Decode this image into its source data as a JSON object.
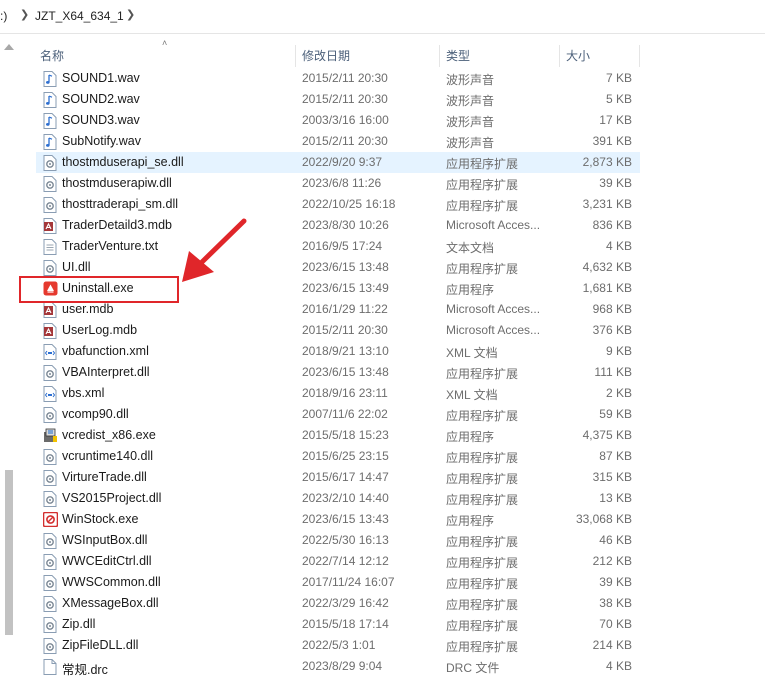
{
  "address": {
    "prefix": ":)",
    "crumb": "JZT_X64_634_1"
  },
  "columns": {
    "name": "名称",
    "date": "修改日期",
    "type": "类型",
    "size": "大小"
  },
  "files": [
    {
      "name": "SOUND1.wav",
      "date": "2015/2/11 20:30",
      "type": "波形声音",
      "size": "7 KB",
      "icon": "audio-file-icon"
    },
    {
      "name": "SOUND2.wav",
      "date": "2015/2/11 20:30",
      "type": "波形声音",
      "size": "5 KB",
      "icon": "audio-file-icon"
    },
    {
      "name": "SOUND3.wav",
      "date": "2003/3/16 16:00",
      "type": "波形声音",
      "size": "17 KB",
      "icon": "audio-file-icon"
    },
    {
      "name": "SubNotify.wav",
      "date": "2015/2/11 20:30",
      "type": "波形声音",
      "size": "391 KB",
      "icon": "audio-file-icon"
    },
    {
      "name": "thostmduserapi_se.dll",
      "date": "2022/9/20 9:37",
      "type": "应用程序扩展",
      "size": "2,873 KB",
      "icon": "dll-file-icon",
      "selected": true
    },
    {
      "name": "thostmduserapiw.dll",
      "date": "2023/6/8 11:26",
      "type": "应用程序扩展",
      "size": "39 KB",
      "icon": "dll-file-icon"
    },
    {
      "name": "thosttraderapi_sm.dll",
      "date": "2022/10/25 16:18",
      "type": "应用程序扩展",
      "size": "3,231 KB",
      "icon": "dll-file-icon"
    },
    {
      "name": "TraderDetaild3.mdb",
      "date": "2023/8/30 10:26",
      "type": "Microsoft Acces...",
      "size": "836 KB",
      "icon": "access-db-icon"
    },
    {
      "name": "TraderVenture.txt",
      "date": "2016/9/5 17:24",
      "type": "文本文档",
      "size": "4 KB",
      "icon": "text-file-icon"
    },
    {
      "name": "UI.dll",
      "date": "2023/6/15 13:48",
      "type": "应用程序扩展",
      "size": "4,632 KB",
      "icon": "dll-file-icon"
    },
    {
      "name": "Uninstall.exe",
      "date": "2023/6/15 13:49",
      "type": "应用程序",
      "size": "1,681 KB",
      "icon": "uninstall-app-icon"
    },
    {
      "name": "user.mdb",
      "date": "2016/1/29 11:22",
      "type": "Microsoft Acces...",
      "size": "968 KB",
      "icon": "access-db-icon"
    },
    {
      "name": "UserLog.mdb",
      "date": "2015/2/11 20:30",
      "type": "Microsoft Acces...",
      "size": "376 KB",
      "icon": "access-db-icon"
    },
    {
      "name": "vbafunction.xml",
      "date": "2018/9/21 13:10",
      "type": "XML 文档",
      "size": "9 KB",
      "icon": "xml-file-icon"
    },
    {
      "name": "VBAInterpret.dll",
      "date": "2023/6/15 13:48",
      "type": "应用程序扩展",
      "size": "111 KB",
      "icon": "dll-file-icon"
    },
    {
      "name": "vbs.xml",
      "date": "2018/9/16 23:11",
      "type": "XML 文档",
      "size": "2 KB",
      "icon": "xml-file-icon"
    },
    {
      "name": "vcomp90.dll",
      "date": "2007/11/6 22:02",
      "type": "应用程序扩展",
      "size": "59 KB",
      "icon": "dll-file-icon"
    },
    {
      "name": "vcredist_x86.exe",
      "date": "2015/5/18 15:23",
      "type": "应用程序",
      "size": "4,375 KB",
      "icon": "installer-icon"
    },
    {
      "name": "vcruntime140.dll",
      "date": "2015/6/25 23:15",
      "type": "应用程序扩展",
      "size": "87 KB",
      "icon": "dll-file-icon"
    },
    {
      "name": "VirtureTrade.dll",
      "date": "2015/6/17 14:47",
      "type": "应用程序扩展",
      "size": "315 KB",
      "icon": "dll-file-icon"
    },
    {
      "name": "VS2015Project.dll",
      "date": "2023/2/10 14:40",
      "type": "应用程序扩展",
      "size": "13 KB",
      "icon": "dll-file-icon"
    },
    {
      "name": "WinStock.exe",
      "date": "2023/6/15 13:43",
      "type": "应用程序",
      "size": "33,068 KB",
      "icon": "winstock-app-icon"
    },
    {
      "name": "WSInputBox.dll",
      "date": "2022/5/30 16:13",
      "type": "应用程序扩展",
      "size": "46 KB",
      "icon": "dll-file-icon"
    },
    {
      "name": "WWCEditCtrl.dll",
      "date": "2022/7/14 12:12",
      "type": "应用程序扩展",
      "size": "212 KB",
      "icon": "dll-file-icon"
    },
    {
      "name": "WWSCommon.dll",
      "date": "2017/11/24 16:07",
      "type": "应用程序扩展",
      "size": "39 KB",
      "icon": "dll-file-icon"
    },
    {
      "name": "XMessageBox.dll",
      "date": "2022/3/29 16:42",
      "type": "应用程序扩展",
      "size": "38 KB",
      "icon": "dll-file-icon"
    },
    {
      "name": "Zip.dll",
      "date": "2015/5/18 17:14",
      "type": "应用程序扩展",
      "size": "70 KB",
      "icon": "dll-file-icon"
    },
    {
      "name": "ZipFileDLL.dll",
      "date": "2022/5/3 1:01",
      "type": "应用程序扩展",
      "size": "214 KB",
      "icon": "dll-file-icon"
    },
    {
      "name": "常规.drc",
      "date": "2023/8/29 9:04",
      "type": "DRC 文件",
      "size": "4 KB",
      "icon": "generic-file-icon"
    }
  ],
  "colors": {
    "highlight": "#e0262a",
    "selected_row": "#e5f3ff",
    "header_text": "#4c607a"
  }
}
